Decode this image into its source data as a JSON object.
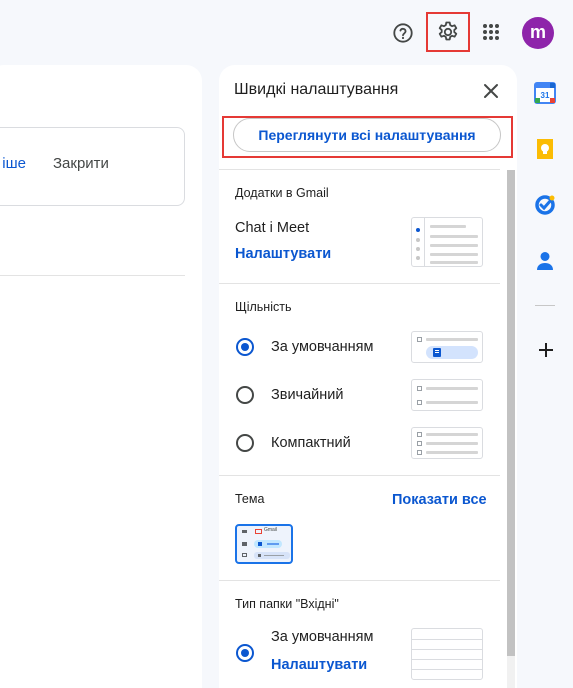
{
  "header": {
    "avatar_initial": "m",
    "help_icon": "help-circle-icon",
    "settings_icon": "gear-icon",
    "apps_icon": "apps-grid-icon"
  },
  "notice": {
    "more_label": "іше",
    "close_label": "Закрити"
  },
  "quick_settings": {
    "title": "Швидкі налаштування",
    "see_all_label": "Переглянути всі налаштування",
    "apps_section": {
      "label": "Додатки в Gmail",
      "item": "Chat і Meet",
      "configure": "Налаштувати"
    },
    "density_section": {
      "label": "Щільність",
      "options": [
        {
          "label": "За умовчанням",
          "selected": true
        },
        {
          "label": "Звичайний",
          "selected": false
        },
        {
          "label": "Компактний",
          "selected": false
        }
      ]
    },
    "theme_section": {
      "label": "Тема",
      "show_all": "Показати все",
      "preview_logo": "Gmail"
    },
    "inbox_section": {
      "label": "Тип папки \"Вхідні\"",
      "option": "За умовчанням",
      "configure": "Налаштувати"
    }
  },
  "side_rail": {
    "icons": [
      "calendar-icon",
      "keep-icon",
      "tasks-icon",
      "contacts-icon",
      "add-icon"
    ],
    "calendar_day": "31"
  },
  "colors": {
    "accent": "#0b57d0",
    "highlight": "#e53935",
    "avatar": "#8e24aa"
  }
}
